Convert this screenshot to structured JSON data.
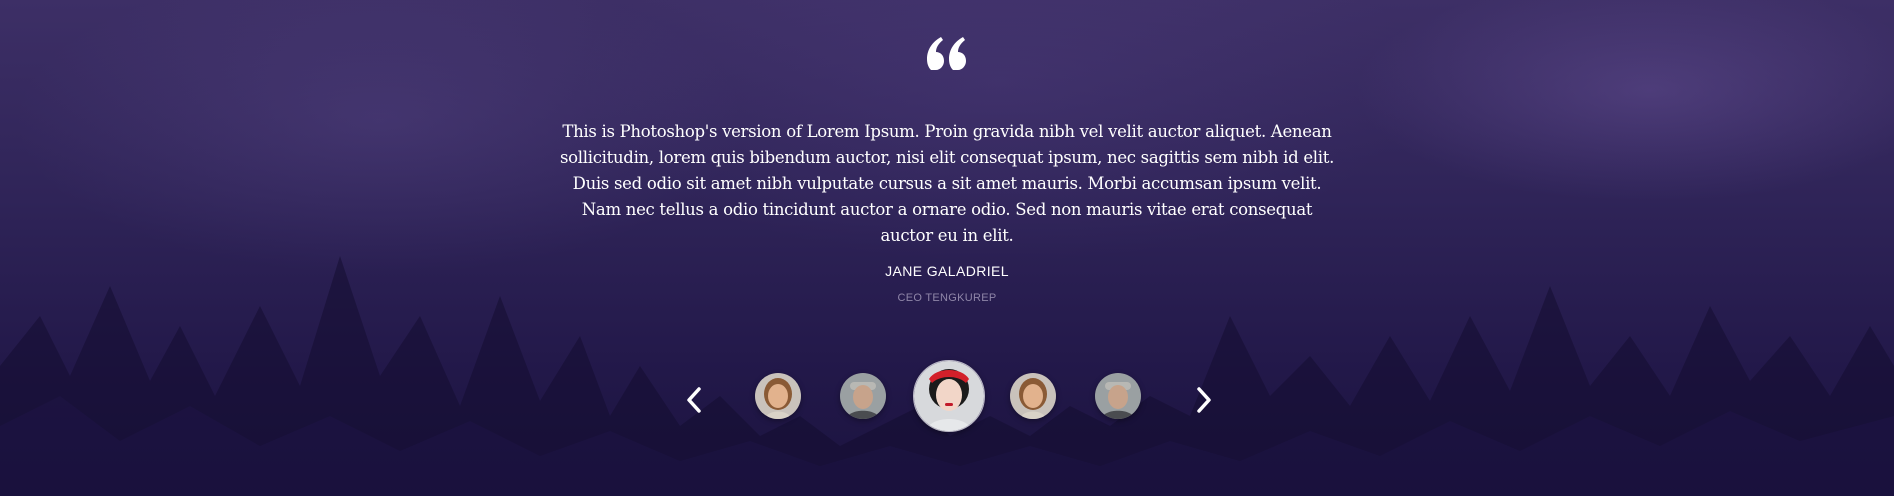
{
  "testimonial": {
    "quote_icon": "quote-icon",
    "text": "This is Photoshop's version of Lorem Ipsum. Proin gravida nibh vel velit auctor aliquet. Aenean sollicitudin, lorem quis bibendum auctor, nisi elit consequat ipsum, nec sagittis sem nibh id elit. Duis sed odio sit amet nibh vulputate cursus a sit amet mauris. Morbi accumsan ipsum velit. Nam nec tellus a odio tincidunt auctor a ornare odio. Sed non mauris vitae erat consequat auctor eu in elit.",
    "author_name": "JANE GALADRIEL",
    "author_role": "CEO TENGKUREP"
  },
  "carousel": {
    "prev_icon": "chevron-left-icon",
    "next_icon": "chevron-right-icon",
    "avatars": [
      {
        "name": "avatar-woman",
        "active": false
      },
      {
        "name": "avatar-man",
        "active": false
      },
      {
        "name": "avatar-woman-red-headband",
        "active": true
      },
      {
        "name": "avatar-woman",
        "active": false
      },
      {
        "name": "avatar-man",
        "active": false
      }
    ]
  },
  "colors": {
    "background_top": "#3d2f66",
    "background_bottom": "#1b133f",
    "text_primary": "#ffffff",
    "text_muted": "#8f86a8"
  }
}
